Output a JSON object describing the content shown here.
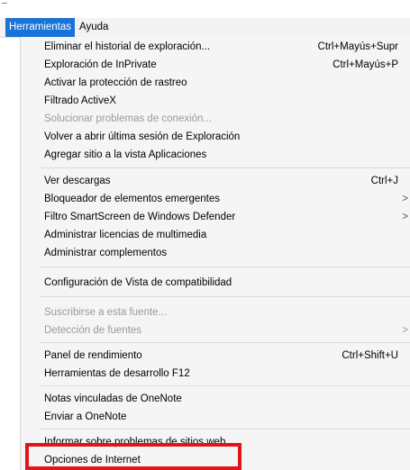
{
  "menubar": {
    "items": [
      {
        "label": "Herramientas",
        "active": true
      },
      {
        "label": "Ayuda",
        "active": false
      }
    ]
  },
  "menu": {
    "items": [
      {
        "label": "Eliminar el historial de exploración...",
        "shortcut": "Ctrl+Mayús+Supr",
        "disabled": false
      },
      {
        "label": "Exploración de InPrivate",
        "shortcut": "Ctrl+Mayús+P",
        "disabled": false
      },
      {
        "label": "Activar la protección de rastreo",
        "shortcut": "",
        "disabled": false
      },
      {
        "label": "Filtrado ActiveX",
        "shortcut": "",
        "disabled": false
      },
      {
        "label": "Solucionar problemas de conexión...",
        "shortcut": "",
        "disabled": true
      },
      {
        "label": "Volver a abrir última sesión de Exploración",
        "shortcut": "",
        "disabled": false
      },
      {
        "label": "Agregar sitio a la vista Aplicaciones",
        "shortcut": "",
        "disabled": false
      },
      {
        "label": "Ver descargas",
        "shortcut": "Ctrl+J",
        "disabled": false
      },
      {
        "label": "Bloqueador de elementos emergentes",
        "shortcut": "",
        "submenu": ">",
        "disabled": false
      },
      {
        "label": "Filtro SmartScreen de Windows Defender",
        "shortcut": "",
        "submenu": ">",
        "disabled": false
      },
      {
        "label": "Administrar licencias de multimedia",
        "shortcut": "",
        "disabled": false
      },
      {
        "label": "Administrar complementos",
        "shortcut": "",
        "disabled": false
      },
      {
        "label": "Configuración de Vista de compatibilidad",
        "shortcut": "",
        "disabled": false
      },
      {
        "label": "Suscribirse a esta fuente...",
        "shortcut": "",
        "disabled": true
      },
      {
        "label": "Detección de fuentes",
        "shortcut": "",
        "submenu": ">",
        "disabled": true
      },
      {
        "label": "Panel de rendimiento",
        "shortcut": "Ctrl+Shift+U",
        "disabled": false
      },
      {
        "label": "Herramientas de desarrollo F12",
        "shortcut": "",
        "disabled": false
      },
      {
        "label": "Notas vinculadas de OneNote",
        "shortcut": "",
        "disabled": false
      },
      {
        "label": "Enviar a OneNote",
        "shortcut": "",
        "disabled": false
      },
      {
        "label": "Informar sobre problemas de sitios web",
        "shortcut": "",
        "disabled": false
      },
      {
        "label": "Opciones de Internet",
        "shortcut": "",
        "disabled": false,
        "highlighted": true
      }
    ]
  },
  "colors": {
    "menubar_active": "#1a73d9",
    "highlight_border": "#e0141a",
    "disabled_text": "#9a9a9a"
  }
}
